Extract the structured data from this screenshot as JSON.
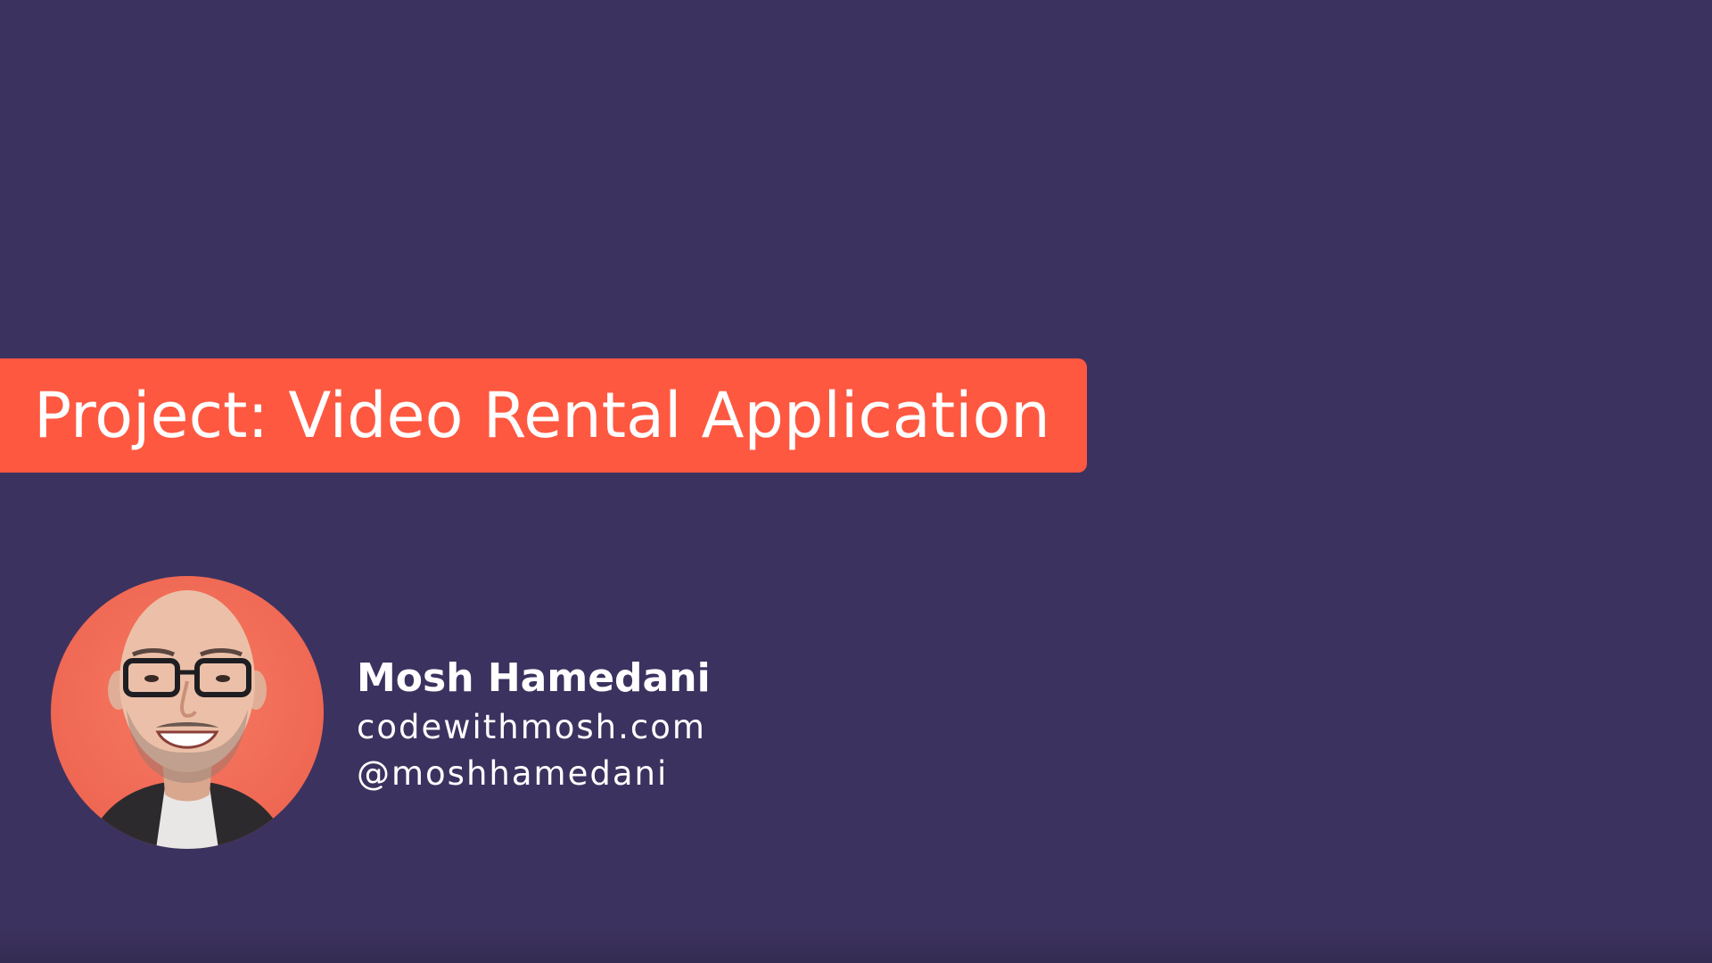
{
  "slide": {
    "title": "Project: Video Rental Application",
    "background_color": "#3c325f",
    "accent_color": "#fe5841"
  },
  "presenter": {
    "name": "Mosh Hamedani",
    "website": "codewithmosh.com",
    "handle": "@moshhamedani",
    "avatar_icon": "presenter-photo"
  }
}
